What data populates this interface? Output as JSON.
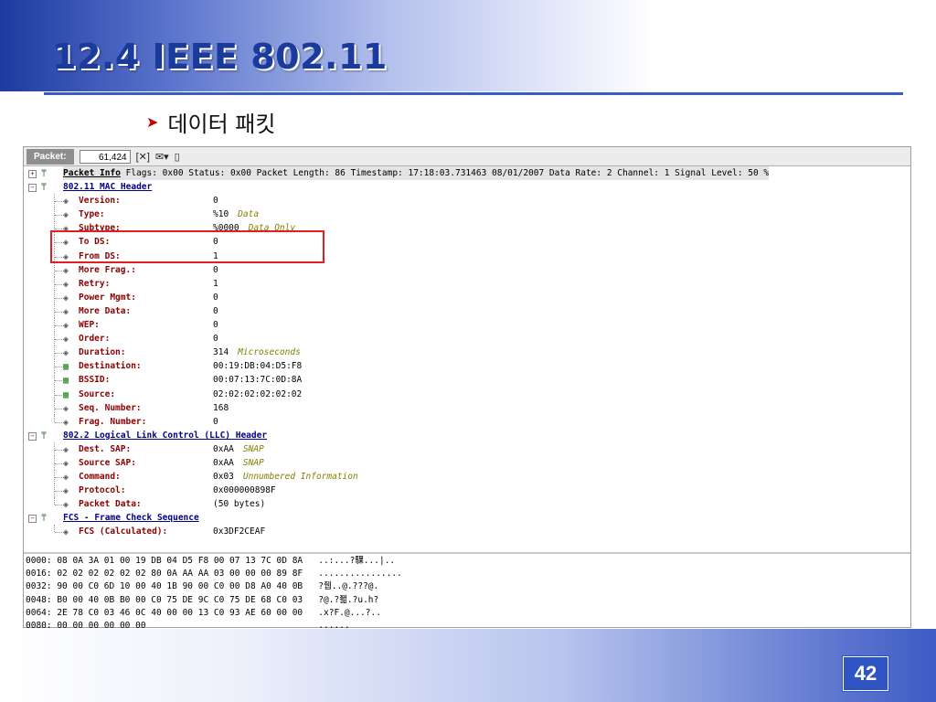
{
  "slide": {
    "title": "12.4 IEEE 802.11",
    "bullet": "데이터 패킷",
    "page_number": "42",
    "accent_color": "#1a3a9c",
    "highlight_color": "#e02020"
  },
  "toolbar": {
    "packet_label": "Packet:",
    "packet_value": "61,424",
    "icons": [
      "close-packet-icon",
      "mail-icon",
      "document-icon"
    ]
  },
  "packet_info": {
    "label": "Packet Info",
    "text": " Flags: 0x00 Status: 0x00 Packet Length: 86 Timestamp: 17:18:03.731463 08/01/2007 Data Rate: 2 Channel: 1 Signal Level: 50 %"
  },
  "mac_header": {
    "label": "802.11 MAC Header",
    "fields": [
      {
        "name": "Version:",
        "value": "0",
        "note": ""
      },
      {
        "name": "Type:",
        "value": "%10",
        "note": "Data"
      },
      {
        "name": "Subtype:",
        "value": "%0000",
        "note": "Data Only"
      },
      {
        "name": "To DS:",
        "value": "0",
        "note": ""
      },
      {
        "name": "From DS:",
        "value": "1",
        "note": ""
      },
      {
        "name": "More Frag.:",
        "value": "0",
        "note": ""
      },
      {
        "name": "Retry:",
        "value": "1",
        "note": ""
      },
      {
        "name": "Power Mgmt:",
        "value": "0",
        "note": ""
      },
      {
        "name": "More Data:",
        "value": "0",
        "note": ""
      },
      {
        "name": "WEP:",
        "value": "0",
        "note": ""
      },
      {
        "name": "Order:",
        "value": "0",
        "note": ""
      },
      {
        "name": "Duration:",
        "value": "314",
        "note": "Microseconds"
      },
      {
        "name": "Destination:",
        "value": "00:19:DB:04:D5:F8",
        "note": ""
      },
      {
        "name": "BSSID:",
        "value": "00:07:13:7C:0D:8A",
        "note": ""
      },
      {
        "name": "Source:",
        "value": "02:02:02:02:02:02",
        "note": ""
      },
      {
        "name": "Seq. Number:",
        "value": "168",
        "note": ""
      },
      {
        "name": "Frag. Number:",
        "value": "0",
        "note": ""
      }
    ]
  },
  "llc_header": {
    "label": "802.2 Logical Link Control (LLC) Header",
    "fields": [
      {
        "name": "Dest. SAP:",
        "value": "0xAA",
        "note": "SNAP"
      },
      {
        "name": "Source SAP:",
        "value": "0xAA",
        "note": "SNAP"
      },
      {
        "name": "Command:",
        "value": "0x03",
        "note": "Unnumbered Information"
      },
      {
        "name": "Protocol:",
        "value": "0x000000898F",
        "note": ""
      },
      {
        "name": "Packet Data:",
        "value": "(50 bytes)",
        "note": ""
      }
    ]
  },
  "fcs": {
    "label": "FCS - Frame Check Sequence",
    "fields": [
      {
        "name": "FCS (Calculated):",
        "value": "0x3DF2CEAF",
        "note": ""
      }
    ]
  },
  "hex_dump": [
    "0000: 08 0A 3A 01 00 19 DB 04 D5 F8 00 07 13 7C 0D 8A   ..:...?騍...|..",
    "0016: 02 02 02 02 02 02 80 0A AA AA 03 00 00 00 89 8F   ................",
    "0032: 90 00 C0 6D 10 00 40 1B 90 00 C0 00 D8 A0 40 0B   ?쥅..@.???@.",
    "0048: B0 00 40 0B B0 00 C0 75 DE 9C C0 75 DE 68 C0 03   ?@.?좲.?u.h?",
    "0064: 2E 78 C0 03 46 0C 40 00 00 13 C0 93 AE 60 00 00   .x?F.@...?..",
    "0080: 00 00 00 00 00 00                                 ......"
  ]
}
